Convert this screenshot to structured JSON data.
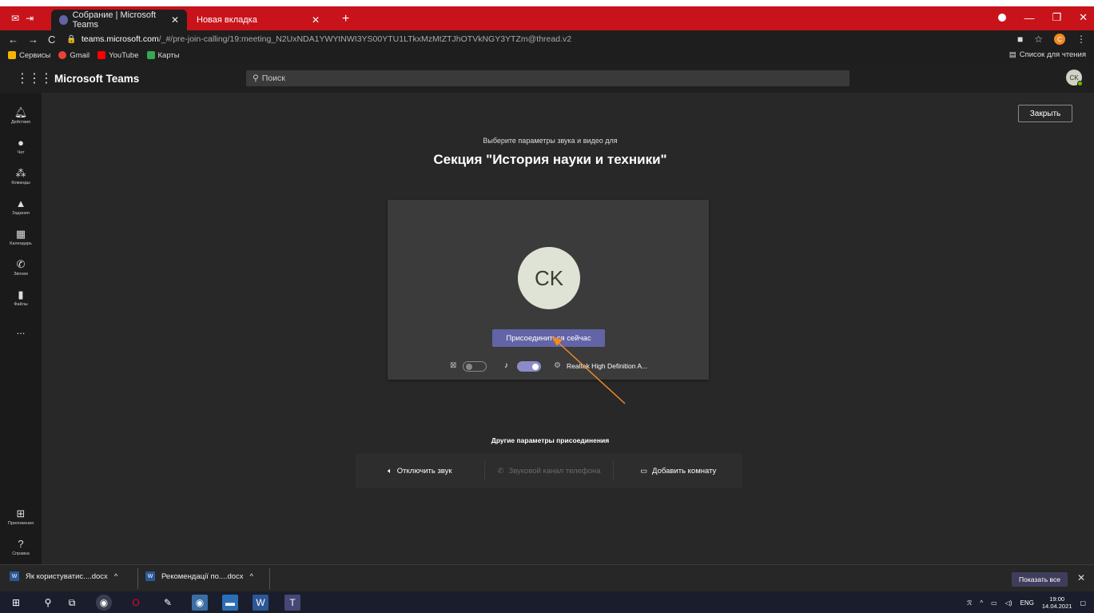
{
  "browser": {
    "tabs": [
      {
        "title": "Собрание | Microsoft Teams",
        "active": true
      },
      {
        "title": "Новая вкладка",
        "active": false
      }
    ],
    "url_host": "teams.microsoft.com",
    "url_path": "/_#/pre-join-calling/19:meeting_N2UxNDA1YWYtNWI3YS00YTU1LTkxMzMtZTJhOTVkNGY3YTZm@thread.v2",
    "profile_letter": "C",
    "bookmarks": [
      {
        "label": "Сервисы",
        "icon": "apps-grid-icon",
        "color": "#f4b400"
      },
      {
        "label": "Gmail",
        "icon": "google-icon",
        "color": "#ea4335"
      },
      {
        "label": "YouTube",
        "icon": "youtube-icon",
        "color": "#ff0000"
      },
      {
        "label": "Карты",
        "icon": "maps-icon",
        "color": "#34a853"
      }
    ],
    "reading_list": "Список для чтения"
  },
  "teams": {
    "app_title": "Microsoft Teams",
    "search_placeholder": "Поиск",
    "user_initials": "CK",
    "rail": [
      {
        "label": "Действия",
        "icon": "bell-icon",
        "glyph": "🔔"
      },
      {
        "label": "Чат",
        "icon": "chat-icon",
        "glyph": "💬"
      },
      {
        "label": "Команды",
        "icon": "teams-icon",
        "glyph": "👥"
      },
      {
        "label": "Задания",
        "icon": "assignments-icon",
        "glyph": "📋"
      },
      {
        "label": "Календарь",
        "icon": "calendar-icon",
        "glyph": "📅"
      },
      {
        "label": "Звонки",
        "icon": "phone-icon",
        "glyph": "📞"
      },
      {
        "label": "Файлы",
        "icon": "file-icon",
        "glyph": "📄"
      }
    ],
    "rail_more": "...",
    "rail_bottom": [
      {
        "label": "Приложения",
        "icon": "apps-icon",
        "glyph": "⊞"
      },
      {
        "label": "Справка",
        "icon": "help-icon",
        "glyph": "?"
      }
    ],
    "close_label": "Закрыть",
    "subtitle": "Выберите параметры звука и видео для",
    "meeting_title": "Секция \"История науки и техники\"",
    "avatar_initials": "CK",
    "join_label": "Присоединиться сейчас",
    "camera_on": false,
    "mic_on": true,
    "audio_device": "Realtek High Definition A...",
    "other_title": "Другие параметры присоединения",
    "other_options": [
      {
        "label": "Отключить звук",
        "icon": "speaker-mute-icon",
        "disabled": false
      },
      {
        "label": "Звуковой канал телефона",
        "icon": "phone-icon",
        "disabled": true
      },
      {
        "label": "Добавить комнату",
        "icon": "cast-icon",
        "disabled": false
      }
    ],
    "accent_color": "#6264a7",
    "annotation_arrow_color": "#f08a24"
  },
  "downloads": {
    "items": [
      {
        "name": "Як користуватис....docx"
      },
      {
        "name": "Рекомендації по....docx"
      }
    ],
    "show_all": "Показать все"
  },
  "taskbar": {
    "lang": "ENG",
    "time": "19:00",
    "date": "14.04.2021"
  }
}
